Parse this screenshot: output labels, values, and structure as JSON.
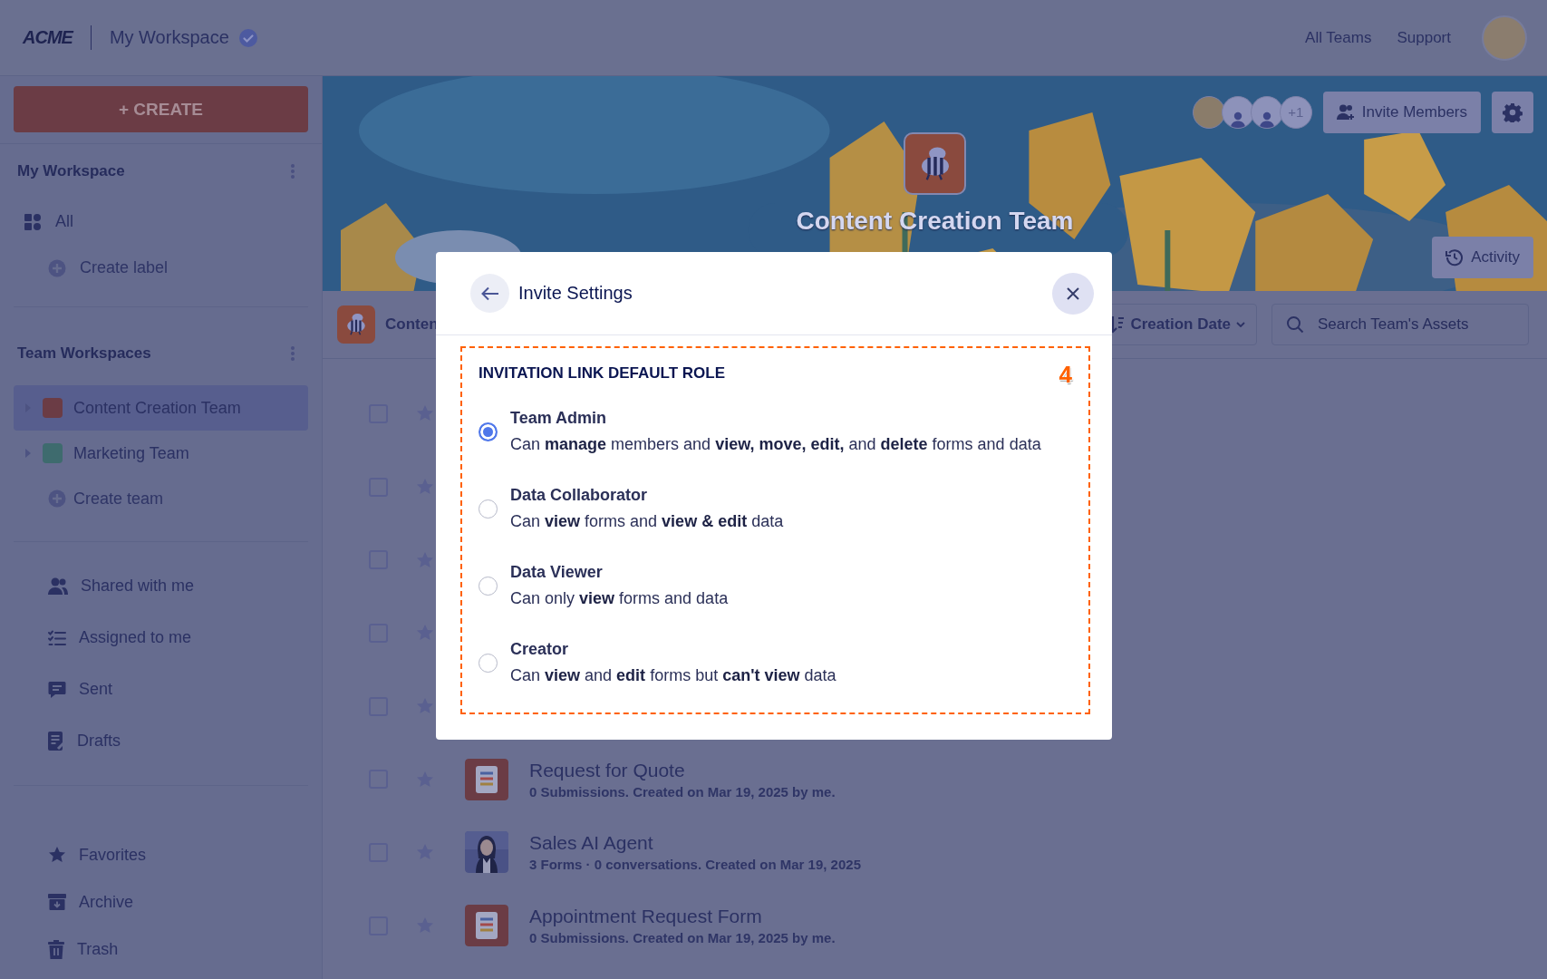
{
  "top_bar": {
    "logo": "ACME",
    "workspace": "My Workspace",
    "links": [
      "All Teams",
      "Support"
    ]
  },
  "sidebar": {
    "create_button": "+ CREATE",
    "my_workspace": {
      "title": "My Workspace",
      "all": "All",
      "create_label": "Create label"
    },
    "team_workspaces": {
      "title": "Team Workspaces",
      "teams": [
        {
          "name": "Content Creation Team",
          "color": "#6b3c45",
          "selected": true
        },
        {
          "name": "Marketing Team",
          "color": "#3e6b6e",
          "selected": false
        }
      ],
      "create_team": "Create team"
    },
    "nav": [
      "Shared with me",
      "Assigned to me",
      "Sent",
      "Drafts"
    ],
    "footer_nav": [
      "Favorites",
      "Archive",
      "Trash"
    ]
  },
  "team_banner": {
    "team_name": "Content Creation Team",
    "extra_members": "+1",
    "invite_button": "Invite Members",
    "activity_button": "Activity"
  },
  "toolbar": {
    "team_label": "Conten",
    "sort_button": "Creation Date",
    "search": {
      "placeholder": "Search Team's Assets"
    }
  },
  "assets": [
    {
      "checked": false
    },
    {
      "checked": false
    },
    {
      "checked": false
    },
    {
      "checked": false
    },
    {
      "checked": false
    },
    {
      "checked": false,
      "kind": "form",
      "title": "Request for Quote",
      "meta": "0 Submissions. Created on Mar 19, 2025 by me."
    },
    {
      "checked": false,
      "kind": "agent",
      "title": "Sales AI Agent",
      "meta": "3 Forms · 0 conversations. Created on Mar 19, 2025"
    },
    {
      "checked": false,
      "kind": "form",
      "title": "Appointment Request Form",
      "meta": "0 Submissions. Created on Mar 19, 2025 by me."
    }
  ],
  "dialog": {
    "title": "Invite Settings",
    "section_title": "INVITATION LINK DEFAULT ROLE",
    "step_marker": "4",
    "roles": [
      {
        "name": "Team Admin",
        "description": "Can **manage** members and **view, move, edit,** and **delete** forms and data",
        "selected": true
      },
      {
        "name": "Data Collaborator",
        "description": "Can **view** forms and **view & edit** data",
        "selected": false
      },
      {
        "name": "Data Viewer",
        "description": "Can only **view** forms and data",
        "selected": false
      },
      {
        "name": "Creator",
        "description": "Can **view** and **edit** forms but **can't view** data",
        "selected": false
      }
    ]
  }
}
